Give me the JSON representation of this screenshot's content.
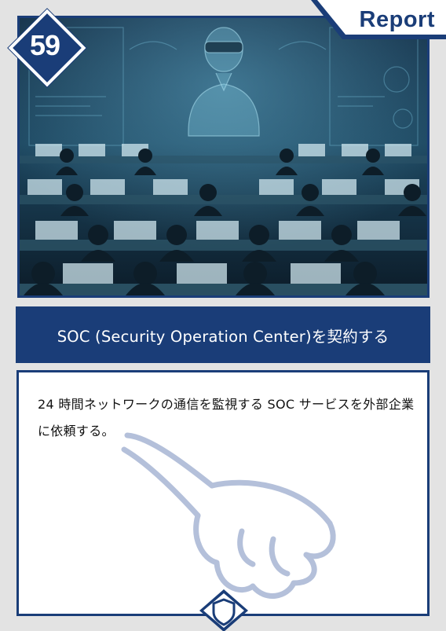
{
  "card": {
    "number": "59",
    "type_label": "Report",
    "title": "SOC (Security Operation Center)を契約する",
    "description": "24 時間ネットワークの通信を監視する SOC サービスを外部企業に依頼する。",
    "colors": {
      "navy": "#1a3d78",
      "frame": "#e3e3e3",
      "panel": "#ffffff",
      "hand": "#b4c0da"
    },
    "icons": [
      "pointing-hand-icon",
      "shield-icon"
    ]
  }
}
